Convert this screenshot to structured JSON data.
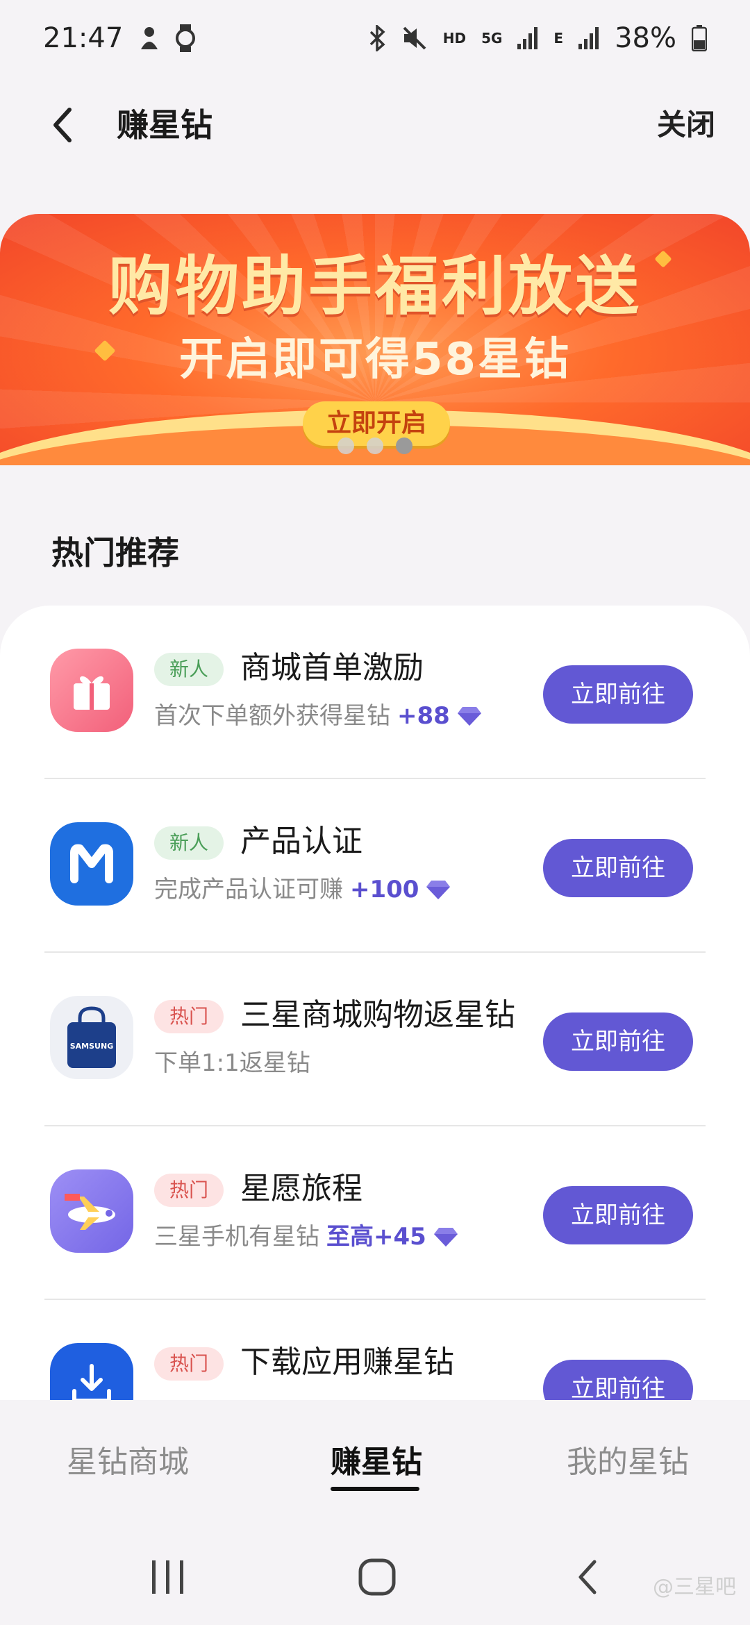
{
  "status_bar": {
    "time": "21:47",
    "network_hd": "HD",
    "network_5g": "5G",
    "network_e": "E",
    "battery": "38%"
  },
  "header": {
    "title": "赚星钻",
    "close_label": "关闭"
  },
  "banner": {
    "title": "购物助手福利放送",
    "subtitle": "开启即可得58星钻",
    "button_label": "立即开启",
    "slide_count": 3,
    "active_slide": 3
  },
  "section": {
    "title": "热门推荐"
  },
  "items": [
    {
      "tag": "新人",
      "title": "商城首单激励",
      "desc": "首次下单额外获得星钻",
      "reward": "+88",
      "button": "立即前往",
      "icon": "gift-icon"
    },
    {
      "tag": "新人",
      "title": "产品认证",
      "desc": "完成产品认证可赚",
      "reward": "+100",
      "button": "立即前往",
      "icon": "members-icon"
    },
    {
      "tag": "热门",
      "title": "三星商城购物返星钻",
      "desc": "下单1:1返星钻",
      "reward": "",
      "button": "立即前往",
      "icon": "samsung-shop-icon",
      "icon_text": "SAMSUNG"
    },
    {
      "tag": "热门",
      "title": "星愿旅程",
      "desc": "三星手机有星钻",
      "reward": "至高+45",
      "button": "立即前往",
      "icon": "airplane-icon"
    },
    {
      "tag": "热门",
      "title": "下载应用赚星钻",
      "desc": "",
      "reward": "",
      "button": "立即前往",
      "icon": "download-icon"
    }
  ],
  "tabs": [
    {
      "label": "星钻商城",
      "active": false
    },
    {
      "label": "赚星钻",
      "active": true
    },
    {
      "label": "我的星钻",
      "active": false
    }
  ],
  "watermark": "@三星吧",
  "colors": {
    "accent": "#6258d4",
    "new_tag": "#4a9e58",
    "hot_tag": "#d9534f",
    "banner": "#ff6a2b"
  }
}
